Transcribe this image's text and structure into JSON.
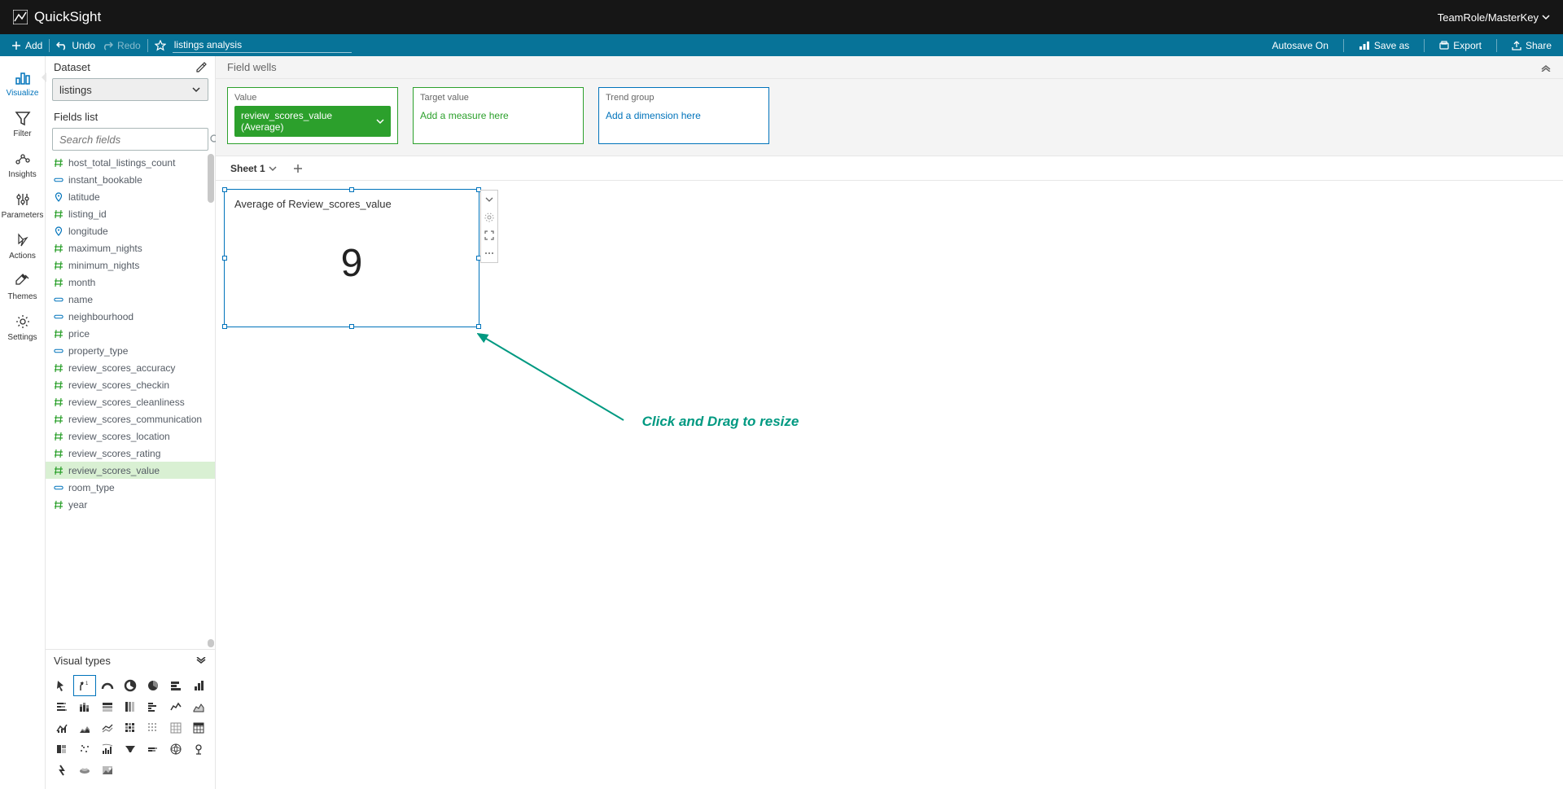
{
  "app": {
    "name": "QuickSight",
    "user": "TeamRole/MasterKey"
  },
  "toolbar": {
    "add": "Add",
    "undo": "Undo",
    "redo": "Redo",
    "analysis_name": "listings analysis",
    "autosave": "Autosave On",
    "save_as": "Save as",
    "export": "Export",
    "share": "Share"
  },
  "nav": {
    "visualize": "Visualize",
    "filter": "Filter",
    "insights": "Insights",
    "parameters": "Parameters",
    "actions": "Actions",
    "themes": "Themes",
    "settings": "Settings"
  },
  "dataset": {
    "label": "Dataset",
    "selected": "listings"
  },
  "fields": {
    "header": "Fields list",
    "search_placeholder": "Search fields",
    "items": [
      {
        "name": "host_total_listings_count",
        "type": "number"
      },
      {
        "name": "instant_bookable",
        "type": "string"
      },
      {
        "name": "latitude",
        "type": "geo"
      },
      {
        "name": "listing_id",
        "type": "number"
      },
      {
        "name": "longitude",
        "type": "geo"
      },
      {
        "name": "maximum_nights",
        "type": "number"
      },
      {
        "name": "minimum_nights",
        "type": "number"
      },
      {
        "name": "month",
        "type": "number"
      },
      {
        "name": "name",
        "type": "string"
      },
      {
        "name": "neighbourhood",
        "type": "string"
      },
      {
        "name": "price",
        "type": "number"
      },
      {
        "name": "property_type",
        "type": "string"
      },
      {
        "name": "review_scores_accuracy",
        "type": "number"
      },
      {
        "name": "review_scores_checkin",
        "type": "number"
      },
      {
        "name": "review_scores_cleanliness",
        "type": "number"
      },
      {
        "name": "review_scores_communication",
        "type": "number"
      },
      {
        "name": "review_scores_location",
        "type": "number"
      },
      {
        "name": "review_scores_rating",
        "type": "number"
      },
      {
        "name": "review_scores_value",
        "type": "number",
        "selected": true
      },
      {
        "name": "room_type",
        "type": "string"
      },
      {
        "name": "year",
        "type": "number"
      }
    ]
  },
  "visual_types": {
    "header": "Visual types"
  },
  "field_wells": {
    "header": "Field wells",
    "value": {
      "label": "Value",
      "chip": "review_scores_value (Average)"
    },
    "target": {
      "label": "Target value",
      "placeholder": "Add a measure here"
    },
    "trend": {
      "label": "Trend group",
      "placeholder": "Add a dimension here"
    }
  },
  "sheets": {
    "active": "Sheet 1"
  },
  "visual": {
    "title": "Average of Review_scores_value",
    "value": "9"
  },
  "annotation": {
    "text": "Click and Drag to resize"
  },
  "chart_data": {
    "type": "kpi",
    "title": "Average of Review_scores_value",
    "value": 9,
    "aggregation": "Average",
    "field": "review_scores_value"
  }
}
